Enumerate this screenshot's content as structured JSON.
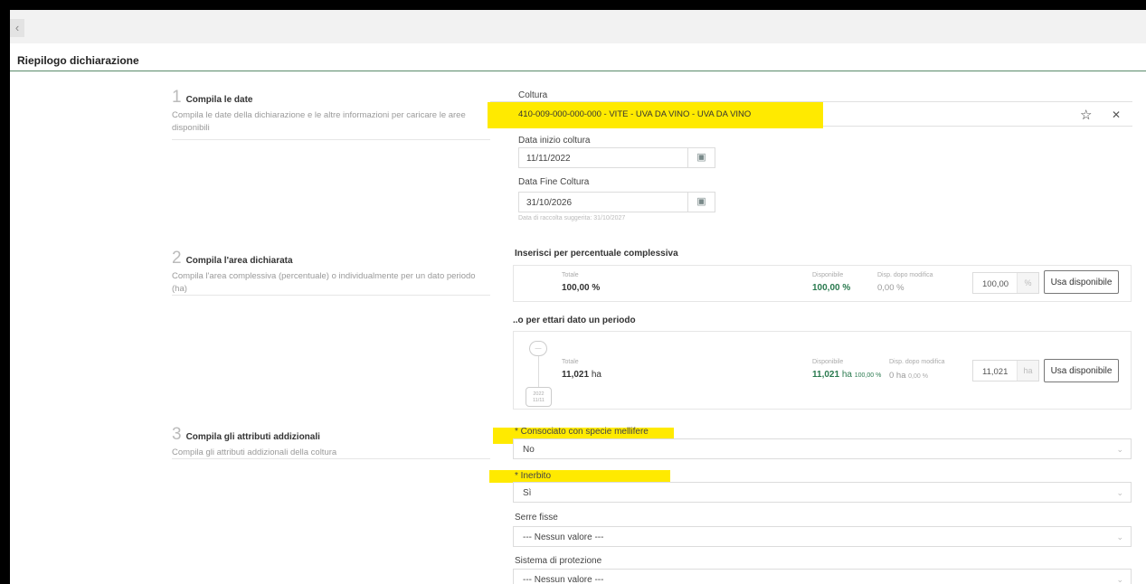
{
  "nav": {
    "back_glyph": "‹"
  },
  "page": {
    "title": "Riepilogo dichiarazione"
  },
  "steps": [
    {
      "num": "1",
      "title": "Compila le date",
      "desc": "Compila le date della dichiarazione e le altre informazioni per caricare le aree disponibili"
    },
    {
      "num": "2",
      "title": "Compila l'area dichiarata",
      "desc": "Compila l'area complessiva (percentuale) o individualmente per un dato periodo (ha)"
    },
    {
      "num": "3",
      "title": "Compila gli attributi addizionali",
      "desc": "Compila gli attributi addizionali della coltura"
    }
  ],
  "coltura": {
    "label": "Coltura",
    "value": "410-009-000-000-000 - VITE - UVA DA VINO - UVA DA VINO",
    "favorite_icon": "star-icon",
    "clear_icon": "close-icon"
  },
  "data_inizio": {
    "label": "Data inizio coltura",
    "value": "11/11/2022"
  },
  "data_fine": {
    "label": "Data Fine Coltura",
    "value": "31/10/2026"
  },
  "hint_raccolta": "Data di raccolta suggerita: 31/10/2027",
  "percentuale": {
    "heading": "Inserisci per percentuale complessiva",
    "totale_label": "Totale",
    "totale_value": "100,00 %",
    "disponibile_label": "Disponibile",
    "disponibile_value": "100,00 %",
    "disp_dopo_label": "Disp. dopo modifica",
    "disp_dopo_value": "0,00 %",
    "input_value": "100,00",
    "unit": "%",
    "button": "Usa disponibile"
  },
  "ettari": {
    "heading": "..o per ettari dato un periodo",
    "timeline_top": "—",
    "timeline_year": "2022",
    "timeline_day": "11/11",
    "totale_label": "Totale",
    "totale_value": "11,021",
    "totale_unit": "ha",
    "disponibile_label": "Disponibile",
    "disponibile_value": "11,021",
    "disponibile_unit": "ha",
    "disponibile_pct": "100,00 %",
    "disp_dopo_label": "Disp. dopo modifica",
    "disp_dopo_value": "0 ha",
    "disp_dopo_pct": "0,00 %",
    "input_value": "11,021",
    "unit": "ha",
    "button": "Usa disponibile"
  },
  "attributi": [
    {
      "label": "* Consociato con specie mellifere",
      "value": "No"
    },
    {
      "label": "* Inerbito",
      "value": "Sì"
    },
    {
      "label": "Serre fisse",
      "value": "--- Nessun valore ---"
    },
    {
      "label": "Sistema di protezione",
      "value": "--- Nessun valore ---"
    }
  ],
  "colors": {
    "highlight": "#ffea00",
    "accent_green": "#2a7a4f",
    "header_rule": "#5a8a6a"
  }
}
